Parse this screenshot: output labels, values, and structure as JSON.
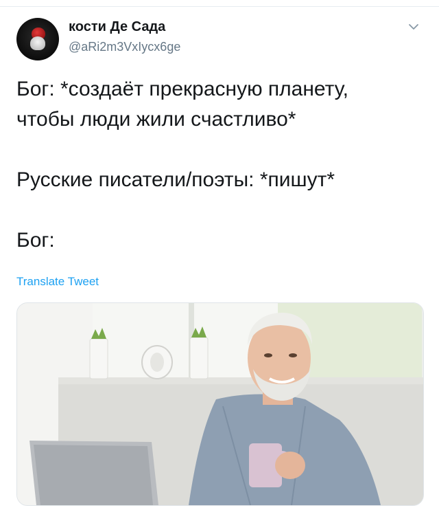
{
  "tweet": {
    "author": {
      "display_name": "кости Де Сада",
      "handle": "@aRi2m3VxIycx6ge"
    },
    "text_lines": [
      "Бог: *создаёт прекрасную планету,",
      "чтобы люди жили счастливо*",
      "",
      "Русские писатели/поэты: *пишут*",
      "",
      "Бог:"
    ],
    "translate_label": "Translate Tweet"
  },
  "icons": {
    "caret": "chevron-down-icon"
  },
  "colors": {
    "text": "#14171a",
    "secondary": "#657786",
    "link": "#1da1f2",
    "border": "#e6ecf0"
  }
}
